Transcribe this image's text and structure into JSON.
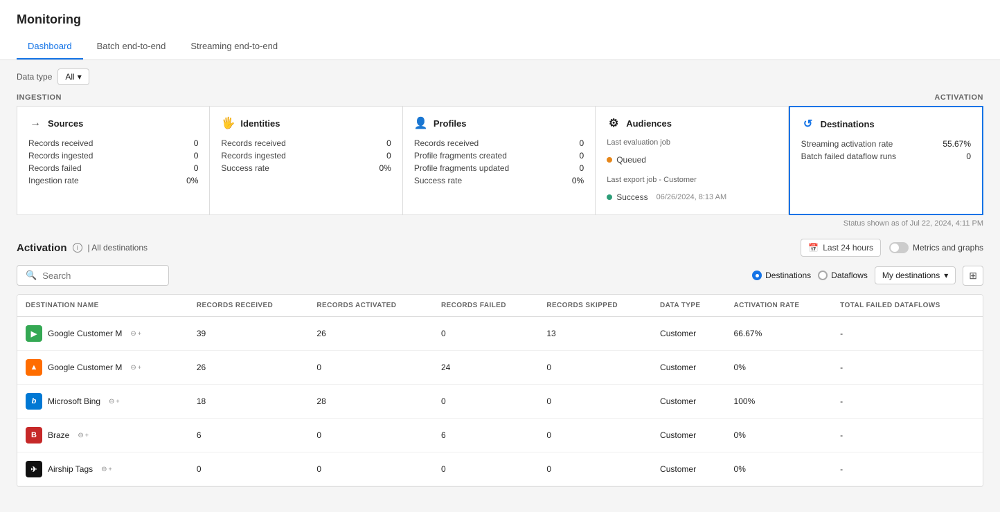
{
  "header": {
    "title": "Monitoring",
    "tabs": [
      {
        "label": "Dashboard",
        "active": true
      },
      {
        "label": "Batch end-to-end",
        "active": false
      },
      {
        "label": "Streaming end-to-end",
        "active": false
      }
    ]
  },
  "filter": {
    "label": "Data type",
    "value": "All"
  },
  "ingestion": {
    "section_label": "INGESTION",
    "cards": [
      {
        "title": "Sources",
        "icon": "arrow-right-icon",
        "rows": [
          {
            "label": "Records received",
            "value": "0"
          },
          {
            "label": "Records ingested",
            "value": "0"
          },
          {
            "label": "Records failed",
            "value": "0"
          },
          {
            "label": "Ingestion rate",
            "value": "0%"
          }
        ]
      },
      {
        "title": "Identities",
        "icon": "fingerprint-icon",
        "rows": [
          {
            "label": "Records received",
            "value": "0"
          },
          {
            "label": "Records ingested",
            "value": "0"
          },
          {
            "label": "Success rate",
            "value": "0%"
          }
        ]
      },
      {
        "title": "Profiles",
        "icon": "user-icon",
        "rows": [
          {
            "label": "Records received",
            "value": "0"
          },
          {
            "label": "Profile fragments created",
            "value": "0"
          },
          {
            "label": "Profile fragments updated",
            "value": "0"
          },
          {
            "label": "Success rate",
            "value": "0%"
          }
        ]
      }
    ]
  },
  "audiences_card": {
    "title": "Audiences",
    "icon": "audiences-icon",
    "last_evaluation_label": "Last evaluation job",
    "queued_label": "Queued",
    "last_export_label": "Last export job - Customer",
    "success_label": "Success",
    "success_date": "06/26/2024, 8:13 AM"
  },
  "destinations_card": {
    "title": "Destinations",
    "icon": "destinations-icon",
    "streaming_rate_label": "Streaming activation rate",
    "streaming_rate_value": "55.67%",
    "batch_failed_label": "Batch failed dataflow runs",
    "batch_failed_value": "0",
    "active": true
  },
  "activation": {
    "section_label": "ACTIVATION",
    "title": "Activation",
    "all_destinations_label": "| All destinations",
    "time_filter_label": "Last 24 hours",
    "metrics_label": "Metrics and graphs",
    "search_placeholder": "Search",
    "destinations_option": "Destinations",
    "dataflows_option": "Dataflows",
    "my_destinations_label": "My destinations",
    "status_text": "Status shown as of Jul 22, 2024, 4:11 PM"
  },
  "table": {
    "columns": [
      "DESTINATION NAME",
      "RECORDS RECEIVED",
      "RECORDS ACTIVATED",
      "RECORDS FAILED",
      "RECORDS SKIPPED",
      "DATA TYPE",
      "ACTIVATION RATE",
      "TOTAL FAILED DATAFLOWS"
    ],
    "rows": [
      {
        "name": "Google Customer M",
        "logo_text": "▶",
        "logo_type": "green",
        "records_received": "39",
        "records_activated": "26",
        "records_failed": "0",
        "records_skipped": "13",
        "data_type": "Customer",
        "activation_rate": "66.67%",
        "total_failed": "-"
      },
      {
        "name": "Google Customer M",
        "logo_text": "▲",
        "logo_type": "orange",
        "records_received": "26",
        "records_activated": "0",
        "records_failed": "24",
        "records_skipped": "0",
        "data_type": "Customer",
        "activation_rate": "0%",
        "total_failed": "-"
      },
      {
        "name": "Microsoft Bing",
        "logo_text": "b",
        "logo_type": "blue",
        "records_received": "18",
        "records_activated": "28",
        "records_failed": "0",
        "records_skipped": "0",
        "data_type": "Customer",
        "activation_rate": "100%",
        "total_failed": "-"
      },
      {
        "name": "Braze",
        "logo_text": "B",
        "logo_type": "red",
        "records_received": "6",
        "records_activated": "0",
        "records_failed": "6",
        "records_skipped": "0",
        "data_type": "Customer",
        "activation_rate": "0%",
        "total_failed": "-"
      },
      {
        "name": "Airship Tags",
        "logo_text": "✈",
        "logo_type": "airship",
        "records_received": "0",
        "records_activated": "0",
        "records_failed": "0",
        "records_skipped": "0",
        "data_type": "Customer",
        "activation_rate": "0%",
        "total_failed": "-"
      }
    ]
  }
}
